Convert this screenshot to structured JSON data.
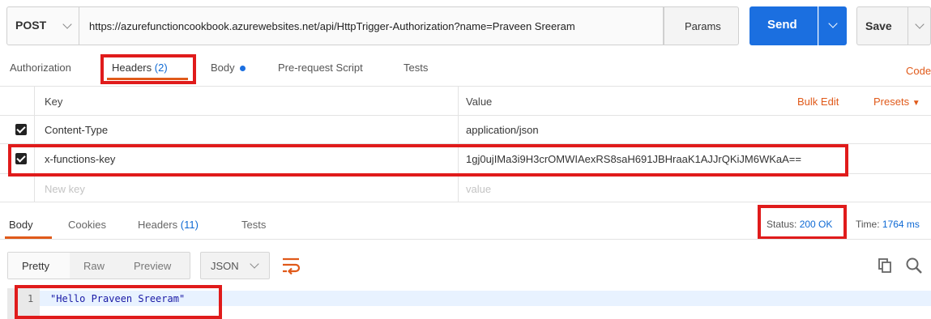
{
  "request": {
    "method": "POST",
    "url": "https://azurefunctioncookbook.azurewebsites.net/api/HttpTrigger-Authorization?name=Praveen Sreeram",
    "params_label": "Params",
    "send_label": "Send",
    "save_label": "Save"
  },
  "request_tabs": {
    "authorization": "Authorization",
    "headers": "Headers",
    "headers_count": "(2)",
    "body": "Body",
    "prerequest": "Pre-request Script",
    "tests": "Tests",
    "code": "Code"
  },
  "headers_table": {
    "key_header": "Key",
    "value_header": "Value",
    "bulk_edit": "Bulk Edit",
    "presets": "Presets",
    "rows": [
      {
        "key": "Content-Type",
        "value": "application/json",
        "checked": true
      },
      {
        "key": "x-functions-key",
        "value": "1gj0ujIMa3i9H3crOMWIAexRS8saH691JBHraaK1AJJrQKiJM6WKaA==",
        "checked": true
      }
    ],
    "new_key_placeholder": "New key",
    "new_value_placeholder": "value"
  },
  "response_tabs": {
    "body": "Body",
    "cookies": "Cookies",
    "headers": "Headers",
    "headers_count": "(11)",
    "tests": "Tests"
  },
  "status": {
    "label": "Status:",
    "value": "200 OK",
    "time_label": "Time:",
    "time_value": "1764 ms"
  },
  "view_modes": {
    "pretty": "Pretty",
    "raw": "Raw",
    "preview": "Preview",
    "format": "JSON"
  },
  "response_body": {
    "line_number": "1",
    "content": "\"Hello Praveen Sreeram\""
  },
  "colors": {
    "accent_blue": "#0f6ad4",
    "orange": "#e05a1a",
    "highlight_red": "#e01b1b",
    "string_blue": "#1a1aa6"
  }
}
